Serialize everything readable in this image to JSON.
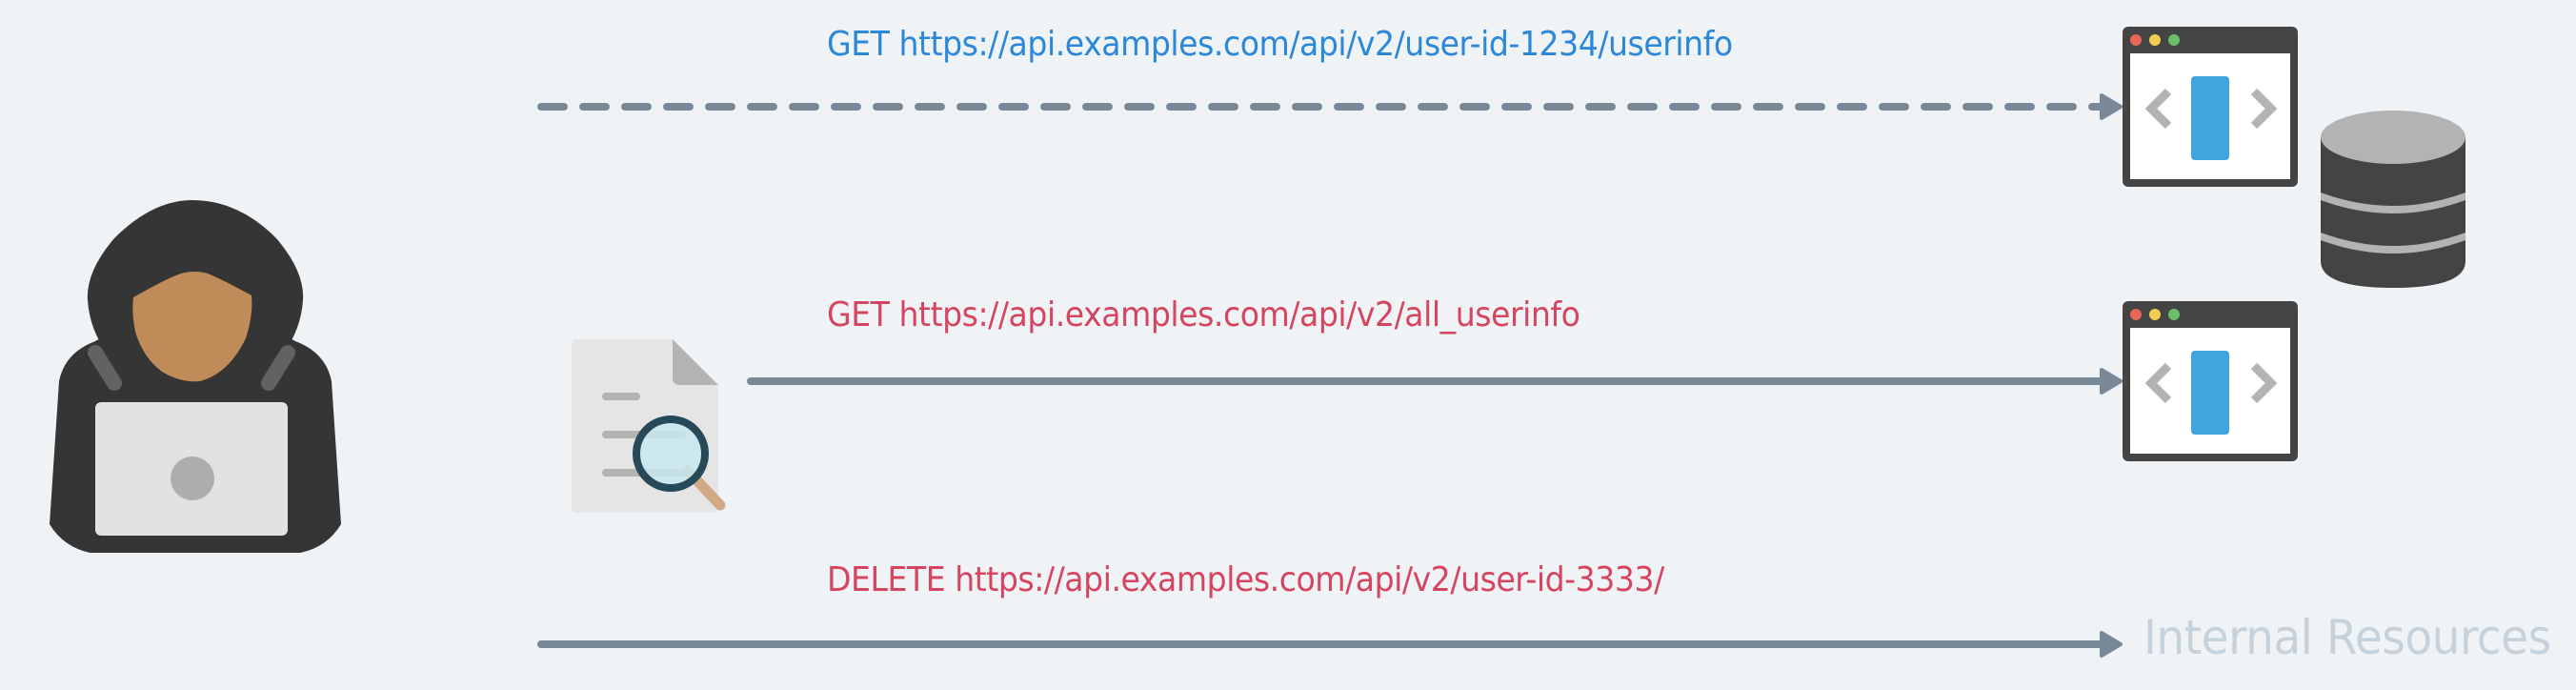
{
  "requests": [
    {
      "method": "GET",
      "url": "https://api.examples.com/api/v2/user-id-1234/userinfo",
      "text": "GET https://api.examples.com/api/v2/user-id-1234/userinfo",
      "color": "#2b87d8",
      "line_style": "dashed"
    },
    {
      "method": "GET",
      "url": "https://api.examples.com/api/v2/all_userinfo",
      "text": "GET https://api.examples.com/api/v2/all_userinfo",
      "color": "#d64560",
      "line_style": "solid"
    },
    {
      "method": "DELETE",
      "url": "https://api.examples.com/api/v2/user-id-3333/",
      "text": "DELETE https://api.examples.com/api/v2/user-id-3333/",
      "color": "#d64560",
      "line_style": "solid"
    }
  ],
  "internal_resources": {
    "label": "Internal Resources",
    "color": "#c5d1db"
  },
  "icons": {
    "attacker": "hooded-hacker-laptop-icon",
    "document": "document-search-icon",
    "api": "browser-window-icon",
    "database": "database-icon"
  },
  "colors": {
    "background": "#eff3f6",
    "arrow": "#788896",
    "browser_frame": "#444444",
    "browser_accent": "#42a6dd",
    "dot_red": "#e76756",
    "dot_yellow": "#efce55",
    "dot_green": "#6bbd6b"
  }
}
